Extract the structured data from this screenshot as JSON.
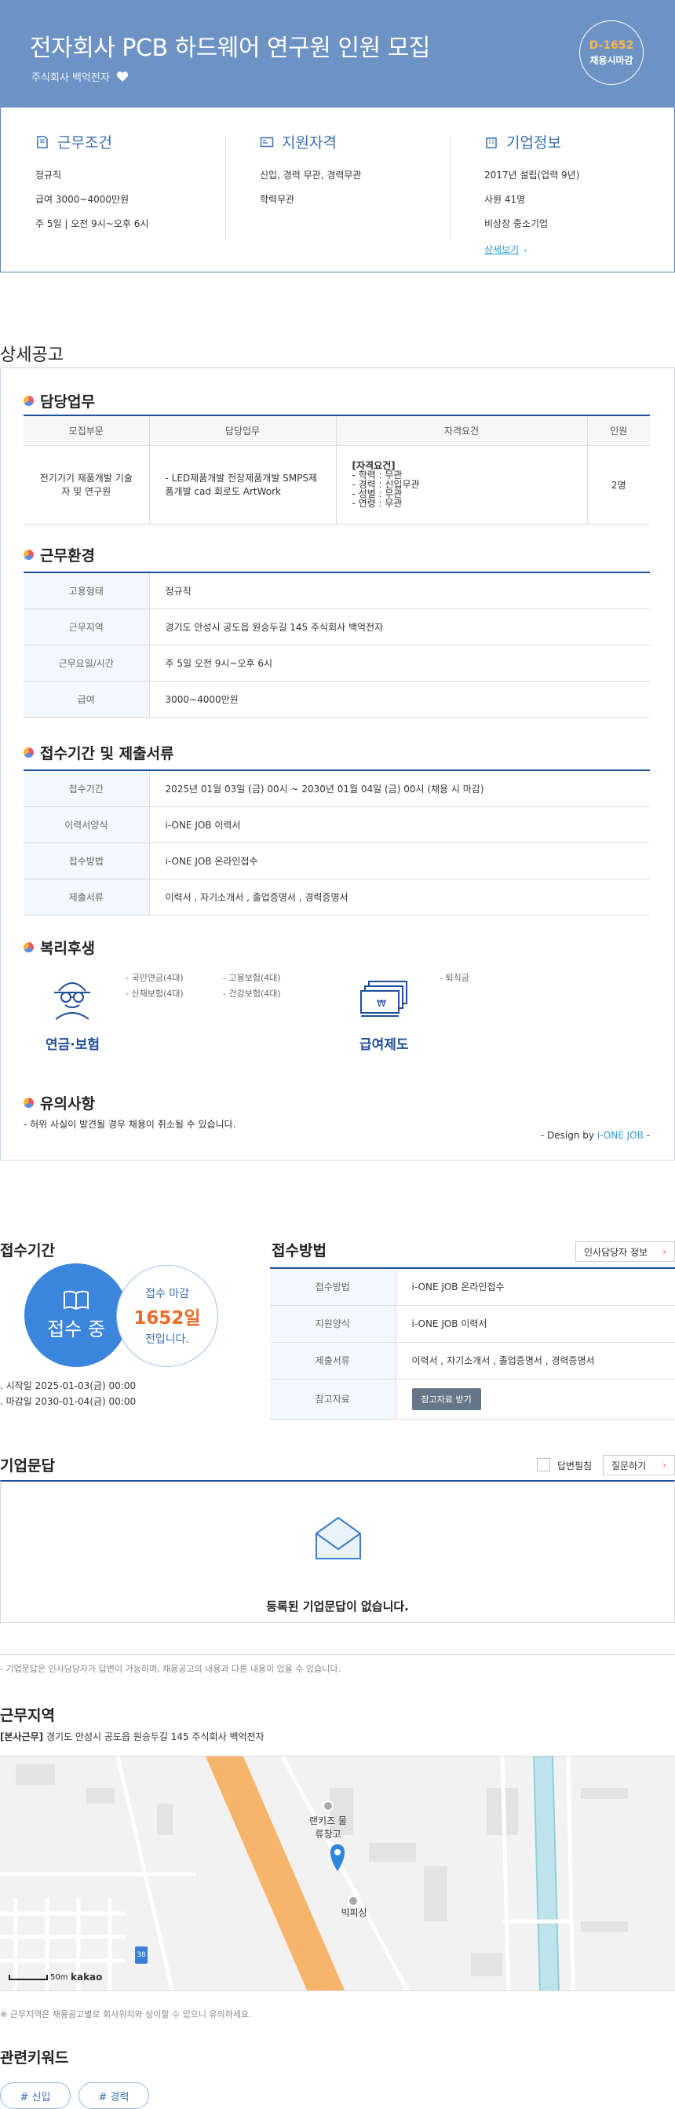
{
  "header": {
    "title": "전자회사 PCB 하드웨어 연구원 인원 모집",
    "company": "주식회사 백억전자",
    "dday": "D-1652",
    "dday_sub": "채용시마감"
  },
  "summary": {
    "work_conditions": {
      "title": "근무조건",
      "items": [
        "정규직",
        "급여 3000~4000만원",
        "주 5일 | 오전 9시~오후 6시"
      ]
    },
    "qualifications": {
      "title": "지원자격",
      "items": [
        "신입, 경력 무관, 경력무관",
        "학력무관"
      ]
    },
    "company_info": {
      "title": "기업정보",
      "items": [
        "2017년 설립(업력 9년)",
        "사원 41명",
        "비상장 중소기업"
      ],
      "link": "상세보기"
    }
  },
  "detail": {
    "section_title": "상세공고",
    "duties": {
      "title": "담당업무",
      "headers": [
        "모집부문",
        "담당업무",
        "자격요건",
        "인원"
      ],
      "row": {
        "part": "전기기기 제품개발 기술자 및 연구원",
        "duty": "- LED제품개발 전장제품개발 SMPS제품개발 cad 회로도 ArtWork",
        "req_title": "[자격요건]",
        "req_lines": [
          "- 학력 : 무관",
          "- 경력 : 신입무관",
          "- 성별 : 무관",
          "- 연령 : 무관"
        ],
        "count": "2명"
      }
    },
    "environment": {
      "title": "근무환경",
      "rows": [
        {
          "k": "고용형태",
          "v": "정규직"
        },
        {
          "k": "근무지역",
          "v": "경기도 안성시 공도읍 원승두길 145 주식회사 백억전자"
        },
        {
          "k": "근무요일/시간",
          "v": "주 5일 오전 9시~오후 6시"
        },
        {
          "k": "급여",
          "v": "3000~4000만원"
        }
      ]
    },
    "submission": {
      "title": "접수기간 및 제출서류",
      "rows": [
        {
          "k": "접수기간",
          "v": "2025년 01월 03일 (금) 00시 ~ 2030년 01월 04일 (금) 00시 (채용 시 마감)"
        },
        {
          "k": "이력서양식",
          "v": "i-ONE JOB 이력서"
        },
        {
          "k": "접수방법",
          "v": "i-ONE JOB 온라인접수"
        },
        {
          "k": "제출서류",
          "v": "이력서 , 자기소개서 , 졸업증명서 , 경력증명서"
        }
      ]
    },
    "welfare": {
      "title": "복리후생",
      "items_a": [
        "- 국민연금(4대)",
        "- 고용보험(4대)",
        "- 산재보험(4대)",
        "- 건강보험(4대)"
      ],
      "items_b": [
        "- 퇴직금"
      ],
      "label_a": "연금·보험",
      "label_b": "급여제도"
    },
    "caution": {
      "title": "유의사항",
      "text": "- 허위 사실이 발견될 경우 채용이 취소될 수 있습니다."
    },
    "design_prefix": "- Design by ",
    "design_brand": "i-ONE JOB",
    "design_suffix": " -"
  },
  "period": {
    "title": "접수기간",
    "status": "접수 중",
    "deadline_label": "접수 마감",
    "deadline_days": "1652일",
    "deadline_suffix": "전입니다.",
    "start": "시작일 2025-01-03(금) 00:00",
    "end": "마감일 2030-01-04(금) 00:00"
  },
  "method": {
    "title": "접수방법",
    "hr_button": "인사담당자 정보",
    "rows": [
      {
        "k": "접수방법",
        "v": "i-ONE JOB 온라인접수"
      },
      {
        "k": "지원양식",
        "v": "i-ONE JOB 이력서"
      },
      {
        "k": "제출서류",
        "v": "이력서 , 자기소개서 , 졸업증명서 , 경력증명서"
      }
    ],
    "ref_label": "참고자료",
    "ref_button": "참고자료 받기"
  },
  "qa": {
    "title": "기업문답",
    "checkbox_label": "답변필침",
    "ask_button": "질문하기",
    "empty": "등록된 기업문답이 없습니다.",
    "note": "- 기업문답은 인사담당자가 답변이 가능하며, 채용공고의 내용과 다른 내용이 있을 수 있습니다."
  },
  "location": {
    "title": "근무지역",
    "tag": "[본사근무]",
    "address": "경기도 안성시 공도읍 원승두길 145 주식회사 백억전자",
    "map_labels": [
      "랜키즈 물류창고",
      "빅피싱"
    ],
    "scale": "50m",
    "map_brand": "kakao",
    "road_sign": "38",
    "note": "※ 근무지역은 채용공고별로 회사위치와 상이할 수 있으니 유의하세요."
  },
  "keywords": {
    "title": "관련키워드",
    "items": [
      "# 신입",
      "# 경력"
    ]
  },
  "colors": {
    "header_bg": "#6d93c4",
    "accent_blue": "#1f4e9a",
    "orange": "#ea6a2a",
    "road": "#f6b56b",
    "river": "#bfe3ea"
  }
}
